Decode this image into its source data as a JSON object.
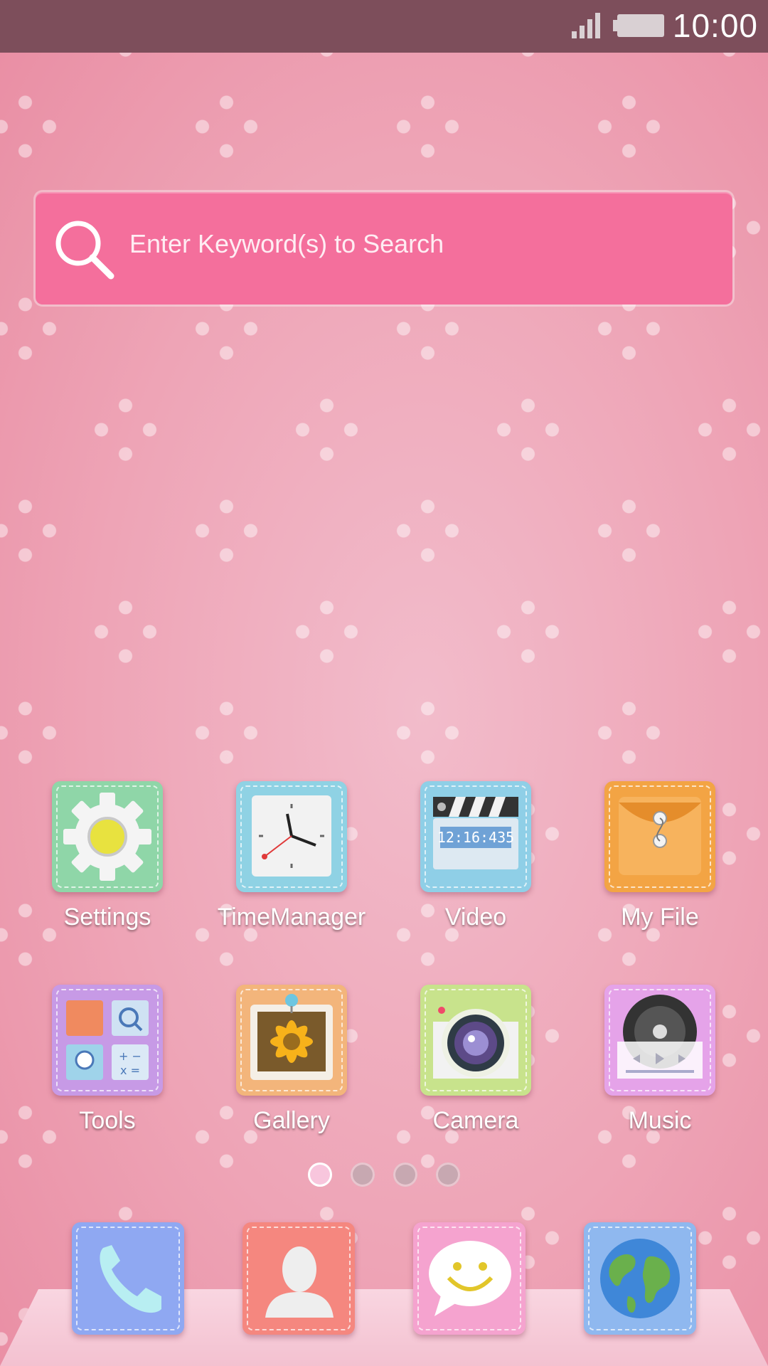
{
  "status_bar": {
    "time": "10:00"
  },
  "search": {
    "placeholder": "Enter Keyword(s) to Search"
  },
  "apps": [
    {
      "label": "Settings",
      "icon": "gear-icon"
    },
    {
      "label": "TimeManager",
      "icon": "clock-icon"
    },
    {
      "label": "Video",
      "icon": "clapperboard-icon",
      "display": "12:16:435"
    },
    {
      "label": "My File",
      "icon": "envelope-folder-icon"
    },
    {
      "label": "Tools",
      "icon": "tools-grid-icon"
    },
    {
      "label": "Gallery",
      "icon": "photo-sunflower-icon"
    },
    {
      "label": "Camera",
      "icon": "camera-lens-icon"
    },
    {
      "label": "Music",
      "icon": "vinyl-player-icon"
    }
  ],
  "page_indicator": {
    "pages": 4,
    "current": 1
  },
  "dock": [
    {
      "icon": "phone-icon"
    },
    {
      "icon": "contacts-icon"
    },
    {
      "icon": "messaging-icon"
    },
    {
      "icon": "browser-globe-icon"
    }
  ],
  "colors": {
    "wallpaper": "#eea4b6",
    "status_bar": "#7d4e5b",
    "search_bar": "#f46f9c"
  }
}
